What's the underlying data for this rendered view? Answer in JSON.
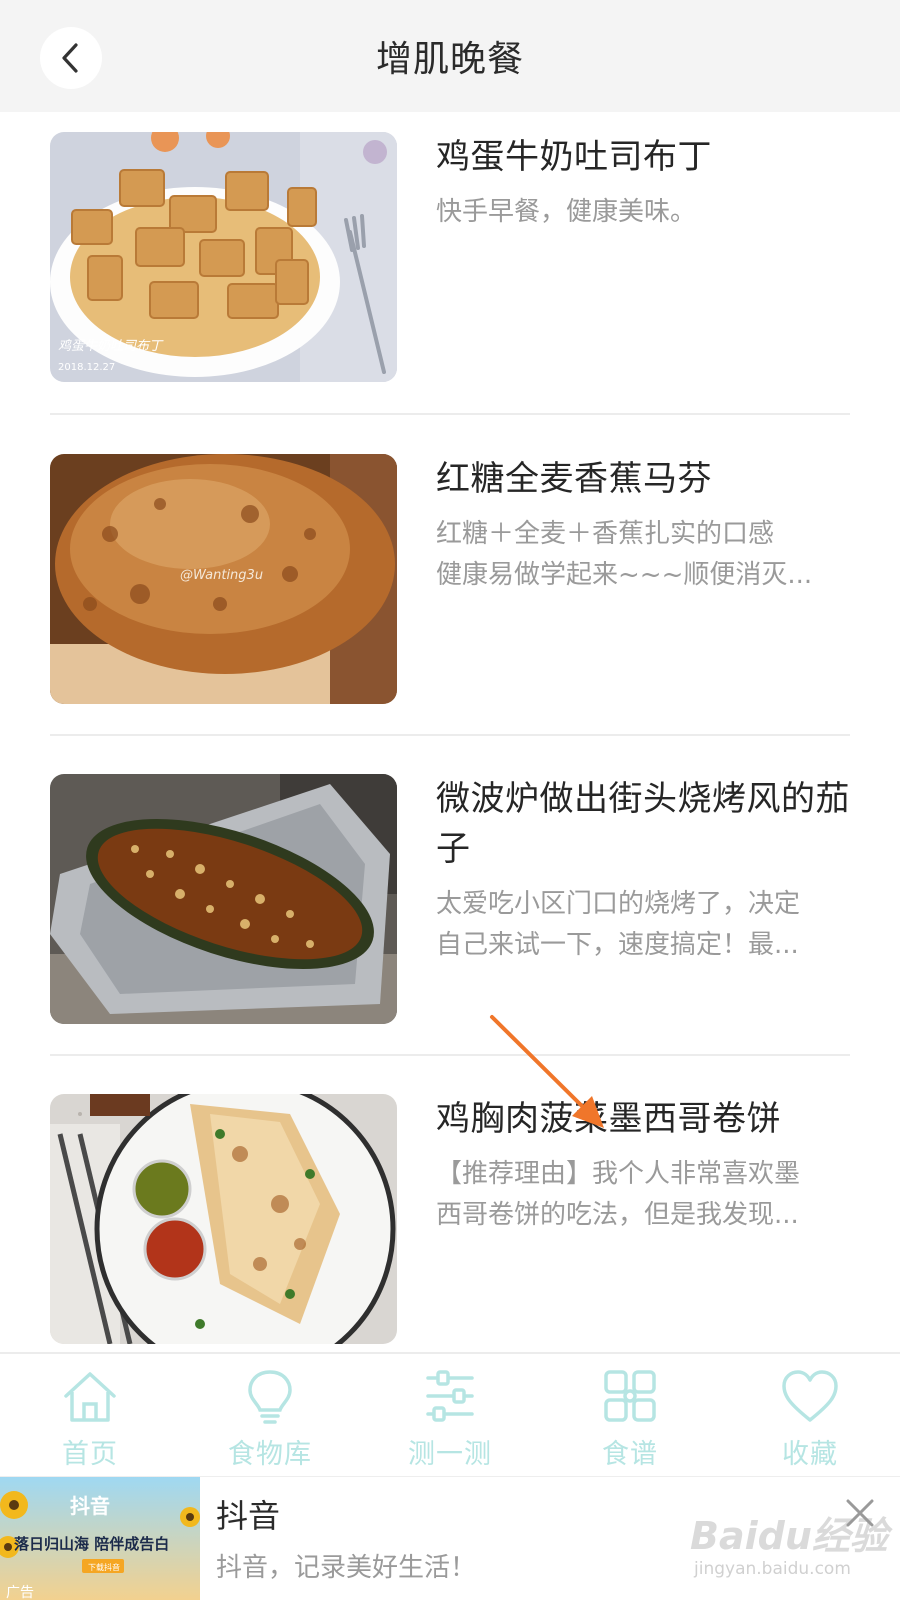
{
  "header": {
    "title": "增肌晚餐",
    "back_icon": "chevron-left-icon"
  },
  "recipes": [
    {
      "title": "鸡蛋牛奶吐司布丁",
      "desc_lines": [
        "快手早餐，健康美味。"
      ],
      "image_caption": "鸡蛋牛奶吐司布丁",
      "image_date": "2018.12.27"
    },
    {
      "title": "红糖全麦香蕉马芬",
      "desc_lines": [
        "红糖＋全麦＋香蕉扎实的口感",
        "健康易做学起来~~~顺便消灭..."
      ],
      "image_watermark": "@Wanting3u"
    },
    {
      "title": "微波炉做出街头烧烤风的茄子",
      "desc_lines": [
        "太爱吃小区门口的烧烤了，决定",
        "自己来试一下，速度搞定！最..."
      ]
    },
    {
      "title": "鸡胸肉菠菜墨西哥卷饼",
      "desc_lines": [
        "【推荐理由】我个人非常喜欢墨",
        "西哥卷饼的吃法，但是我发现..."
      ]
    }
  ],
  "annotation": {
    "type": "arrow",
    "color": "#f0762a"
  },
  "tabbar": {
    "accent_color": "#b6e5e3",
    "tabs": [
      {
        "label": "首页",
        "icon": "home-icon"
      },
      {
        "label": "食物库",
        "icon": "lightbulb-icon"
      },
      {
        "label": "测一测",
        "icon": "sliders-icon"
      },
      {
        "label": "食谱",
        "icon": "grid-icon"
      },
      {
        "label": "收藏",
        "icon": "heart-icon"
      }
    ]
  },
  "ad": {
    "image_brand": "抖音",
    "image_slogan": "落日归山海 陪伴成告白",
    "image_button": "下载抖音",
    "image_tag": "广告",
    "title": "抖音",
    "subtitle": "抖音，记录美好生活！",
    "close_icon": "close-icon"
  },
  "watermark": {
    "logo": "Baidu经验",
    "url": "jingyan.baidu.com"
  }
}
